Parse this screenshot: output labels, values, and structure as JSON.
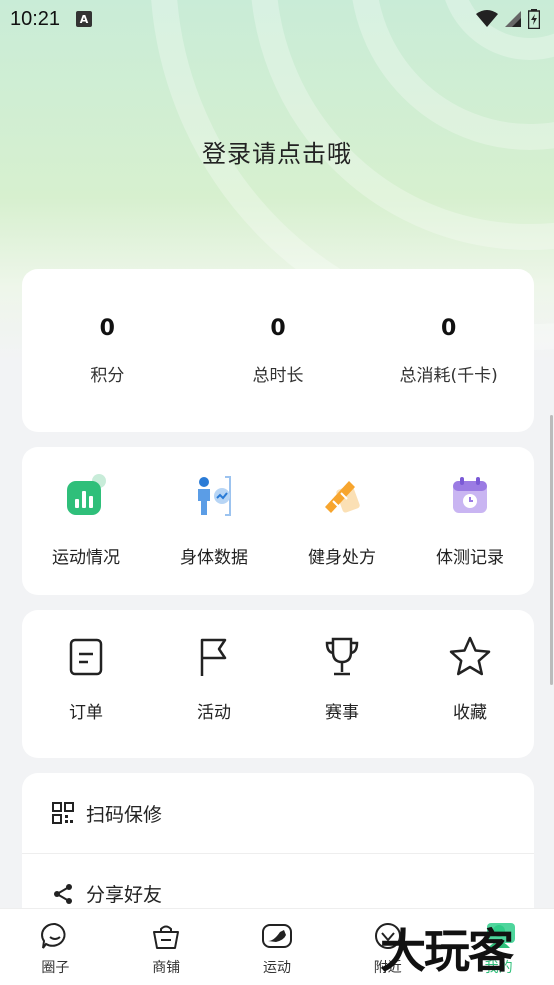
{
  "status_bar": {
    "time": "10:21",
    "notif_badge": "A"
  },
  "header": {
    "login_prompt": "登录请点击哦"
  },
  "stats": [
    {
      "value": "0",
      "label": "积分"
    },
    {
      "value": "0",
      "label": "总时长"
    },
    {
      "value": "0",
      "label": "总消耗(千卡)"
    }
  ],
  "features": [
    {
      "label": "运动情况",
      "icon": "bar-chart-icon"
    },
    {
      "label": "身体数据",
      "icon": "body-data-icon"
    },
    {
      "label": "健身处方",
      "icon": "prescription-icon"
    },
    {
      "label": "体测记录",
      "icon": "calendar-clock-icon"
    }
  ],
  "orders": [
    {
      "label": "订单",
      "icon": "order-icon"
    },
    {
      "label": "活动",
      "icon": "flag-icon"
    },
    {
      "label": "赛事",
      "icon": "trophy-icon"
    },
    {
      "label": "收藏",
      "icon": "star-icon"
    }
  ],
  "list": [
    {
      "label": "扫码保修",
      "icon": "qr-code-icon"
    },
    {
      "label": "分享好友",
      "icon": "share-icon"
    }
  ],
  "tabs": [
    {
      "label": "圈子",
      "icon": "chat-bubble-icon"
    },
    {
      "label": "商铺",
      "icon": "shop-basket-icon"
    },
    {
      "label": "运动",
      "icon": "sneaker-icon"
    },
    {
      "label": "附近",
      "icon": "compass-icon"
    },
    {
      "label": "我的",
      "icon": "profile-icon"
    }
  ],
  "watermark": "大玩客",
  "colors": {
    "accent": "#2fbf7a",
    "hero_start": "#c9ecd7",
    "hero_end": "#d7f0cf"
  }
}
